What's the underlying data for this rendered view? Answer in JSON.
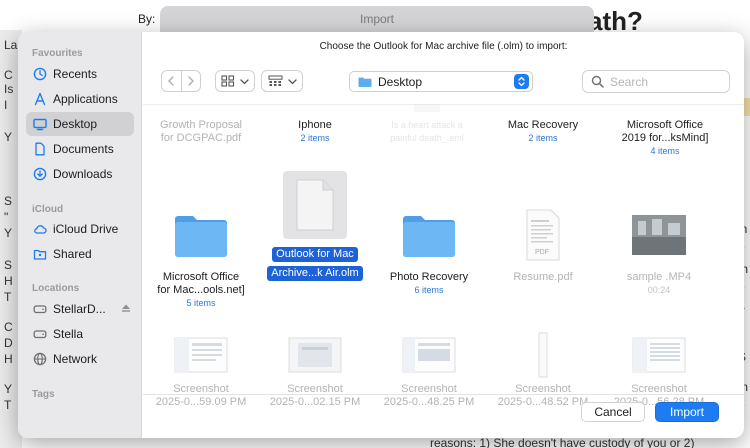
{
  "background": {
    "by_label": "By:",
    "heading_fragment": "ath?",
    "left_letters": [
      "La",
      "C",
      "Is",
      "I",
      "Y",
      "S",
      "\"",
      "Y",
      "S",
      "H",
      "T",
      "C",
      "D",
      "H",
      "Y",
      "T"
    ],
    "right_letters": [
      "in",
      "e",
      "th",
      "e",
      "a",
      "S",
      "m",
      "e"
    ],
    "bottom_fragment": "reasons: 1) She doesn't have custody of you or 2)"
  },
  "dialog": {
    "window_title": "Import",
    "prompt": "Choose the Outlook for Mac archive file (.olm) to import:"
  },
  "sidebar": {
    "sections": [
      {
        "title": "Favourites",
        "items": [
          {
            "label": "Recents",
            "icon": "clock-icon"
          },
          {
            "label": "Applications",
            "icon": "applications-icon"
          },
          {
            "label": "Desktop",
            "icon": "desktop-icon",
            "active": true
          },
          {
            "label": "Documents",
            "icon": "document-icon"
          },
          {
            "label": "Downloads",
            "icon": "download-icon"
          }
        ]
      },
      {
        "title": "iCloud",
        "items": [
          {
            "label": "iCloud Drive",
            "icon": "cloud-icon"
          },
          {
            "label": "Shared",
            "icon": "shared-folder-icon"
          }
        ]
      },
      {
        "title": "Locations",
        "items": [
          {
            "label": "StellarD...",
            "icon": "drive-icon",
            "eject": true
          },
          {
            "label": "Stella",
            "icon": "drive-icon"
          },
          {
            "label": "Network",
            "icon": "globe-icon"
          }
        ]
      },
      {
        "title": "Tags",
        "items": []
      }
    ]
  },
  "toolbar": {
    "location": "Desktop",
    "search_placeholder": "Search"
  },
  "files": {
    "row1": [
      {
        "name": "Growth Proposal for DCGPAC.pdf",
        "line1": "Growth Proposal",
        "line2": "for DCGPAC.pdf",
        "dim": true
      },
      {
        "name": "Iphone",
        "line1": "Iphone",
        "line2": "",
        "meta": "2 items"
      },
      {
        "name": "Is a heart attack a painful death_.eml",
        "line1": "Is a heart attack a",
        "line2": "painful death_.eml",
        "dim": true
      },
      {
        "name": "Mac Recovery",
        "line1": "Mac Recovery",
        "line2": "",
        "meta": "2 items"
      },
      {
        "name": "Microsoft Office 2019 for...ksMind]",
        "line1": "Microsoft Office",
        "line2": "2019 for...ksMind]",
        "meta": "4 items"
      }
    ],
    "row2": [
      {
        "name": "Microsoft Office for Mac...ools.net]",
        "line1": "Microsoft Office",
        "line2": "for Mac...ools.net]",
        "meta": "5 items",
        "kind": "folder"
      },
      {
        "name": "Outlook for Mac Archive...k Air.olm",
        "line1": "Outlook for Mac",
        "line2": "Archive...k Air.olm",
        "kind": "doc",
        "selected": true
      },
      {
        "name": "Photo Recovery",
        "line1": "Photo Recovery",
        "line2": "",
        "meta": "6 items",
        "kind": "folder"
      },
      {
        "name": "Resume.pdf",
        "line1": "Resume.pdf",
        "line2": "",
        "dim": true,
        "kind": "pdf"
      },
      {
        "name": "sample .MP4",
        "line1": "sample .MP4",
        "line2": "",
        "meta": "00:24",
        "dim": true,
        "kind": "video"
      }
    ],
    "row3": [
      {
        "line1": "Screenshot",
        "line2": "2025-0...59.09 PM"
      },
      {
        "line1": "Screenshot",
        "line2": "2025-0...02.15 PM"
      },
      {
        "line1": "Screenshot",
        "line2": "2025-0...48.25 PM"
      },
      {
        "line1": "Screenshot",
        "line2": "2025-0...48.52 PM"
      },
      {
        "line1": "Screenshot",
        "line2": "2025-0...56.28 PM"
      }
    ]
  },
  "footer": {
    "cancel_label": "Cancel",
    "import_label": "Import"
  },
  "colors": {
    "accent": "#1d7cf2",
    "selection": "#1d62d6",
    "folder": "#5aaef0",
    "sidebar_bg": "#e9e9eb"
  }
}
